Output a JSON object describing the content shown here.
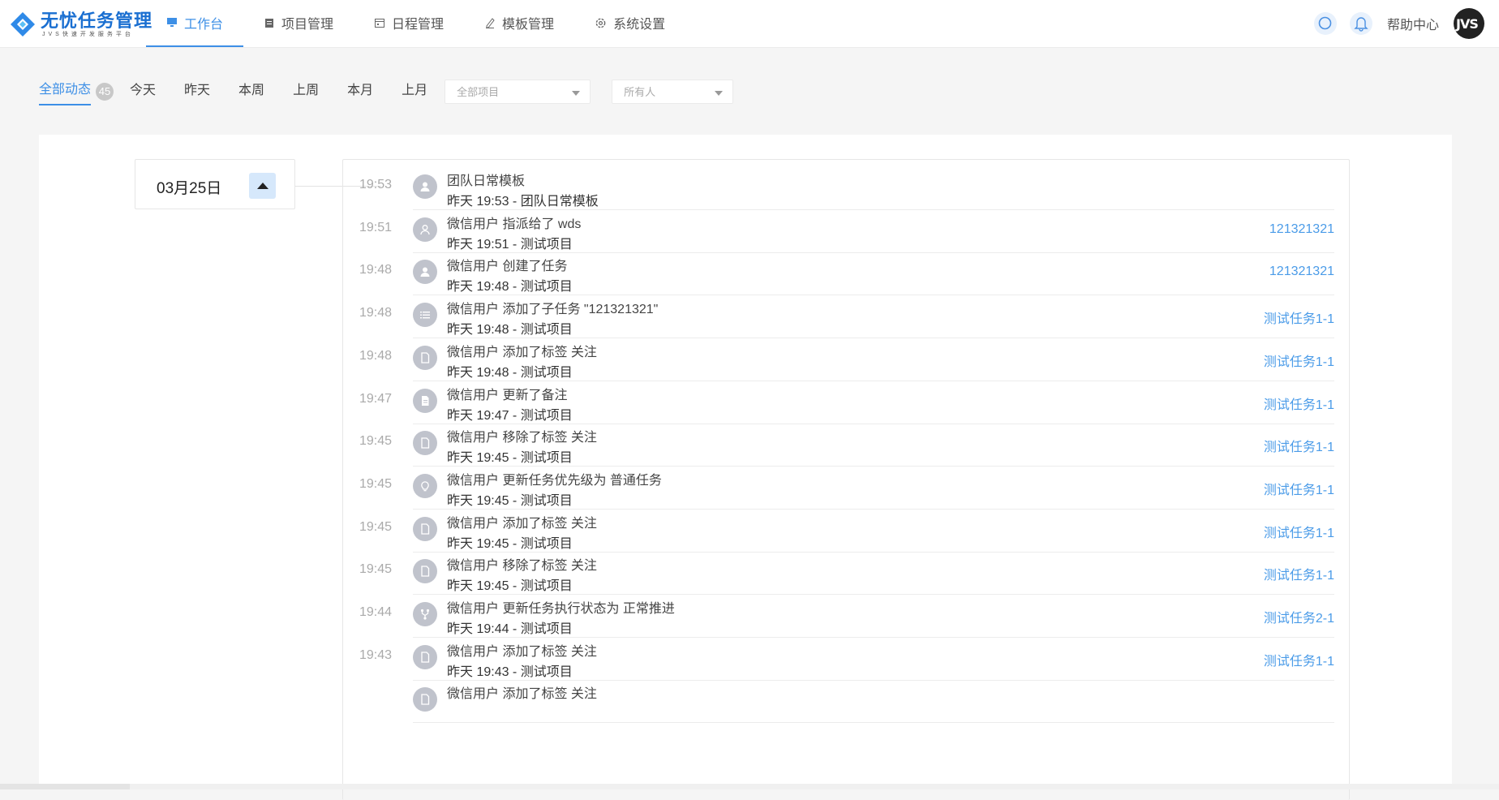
{
  "logo": {
    "title": "无忧任务管理",
    "subtitle": "JVS快速开发服务平台"
  },
  "nav": [
    {
      "label": "工作台",
      "icon": "monitor-icon",
      "active": true
    },
    {
      "label": "项目管理",
      "icon": "clipboard-icon"
    },
    {
      "label": "日程管理",
      "icon": "calendar-icon"
    },
    {
      "label": "模板管理",
      "icon": "pen-icon"
    },
    {
      "label": "系统设置",
      "icon": "gear-icon"
    }
  ],
  "header_right": {
    "help": "帮助中心",
    "avatar_text": "JVS"
  },
  "filters": {
    "all_label": "全部动态",
    "all_count": "45",
    "tabs": [
      "今天",
      "昨天",
      "本周",
      "上周",
      "本月",
      "上月"
    ],
    "project_placeholder": "全部项目",
    "person_placeholder": "所有人"
  },
  "date_group": {
    "label": "03月25日"
  },
  "colors": {
    "accent": "#3d8fe6",
    "link": "#4a9be8",
    "icon_bg": "#c0c3cc"
  },
  "activities": [
    {
      "time": "19:53",
      "icon": "user-icon",
      "text": "团队日常模板",
      "sub": "昨天 19:53 - 团队日常模板",
      "link": ""
    },
    {
      "time": "19:51",
      "icon": "assign-user-icon",
      "text": "微信用户 指派给了 wds",
      "sub": "昨天 19:51 - 测试项目",
      "link": "121321321"
    },
    {
      "time": "19:48",
      "icon": "user-icon",
      "text": "微信用户 创建了任务",
      "sub": "昨天 19:48 - 测试项目",
      "link": "121321321"
    },
    {
      "time": "19:48",
      "icon": "list-icon",
      "text": "微信用户 添加了子任务 \"121321321\"",
      "sub": "昨天 19:48 - 测试项目",
      "link": "测试任务1-1"
    },
    {
      "time": "19:48",
      "icon": "document-icon",
      "text": "微信用户 添加了标签 关注",
      "sub": "昨天 19:48 - 测试项目",
      "link": "测试任务1-1"
    },
    {
      "time": "19:47",
      "icon": "note-icon",
      "text": "微信用户 更新了备注",
      "sub": "昨天 19:47 - 测试项目",
      "link": "测试任务1-1"
    },
    {
      "time": "19:45",
      "icon": "document-icon",
      "text": "微信用户 移除了标签 关注",
      "sub": "昨天 19:45 - 测试项目",
      "link": "测试任务1-1"
    },
    {
      "time": "19:45",
      "icon": "bulb-icon",
      "text": "微信用户 更新任务优先级为 普通任务",
      "sub": "昨天 19:45 - 测试项目",
      "link": "测试任务1-1"
    },
    {
      "time": "19:45",
      "icon": "document-icon",
      "text": "微信用户 添加了标签 关注",
      "sub": "昨天 19:45 - 测试项目",
      "link": "测试任务1-1"
    },
    {
      "time": "19:45",
      "icon": "document-icon",
      "text": "微信用户 移除了标签 关注",
      "sub": "昨天 19:45 - 测试项目",
      "link": "测试任务1-1"
    },
    {
      "time": "19:44",
      "icon": "fork-icon",
      "text": "微信用户 更新任务执行状态为 正常推进",
      "sub": "昨天 19:44 - 测试项目",
      "link": "测试任务2-1"
    },
    {
      "time": "19:43",
      "icon": "document-icon",
      "text": "微信用户 添加了标签 关注",
      "sub": "昨天 19:43 - 测试项目",
      "link": "测试任务1-1"
    },
    {
      "time": "",
      "icon": "document-icon",
      "text": "微信用户 添加了标签 关注",
      "sub": "",
      "link": ""
    }
  ]
}
